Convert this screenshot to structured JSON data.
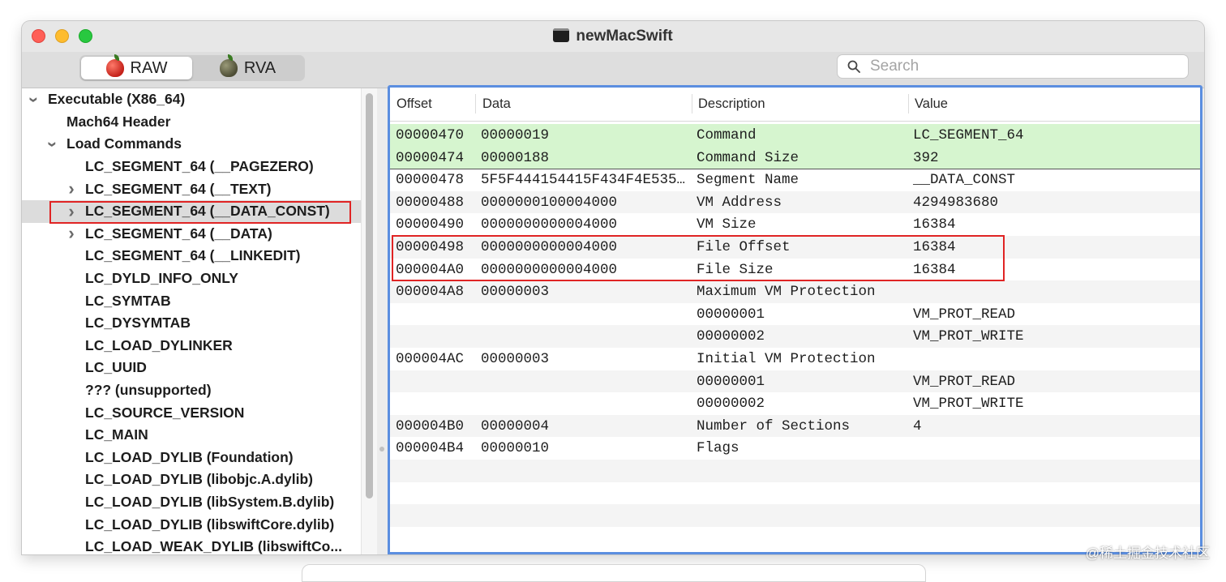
{
  "window": {
    "title": "newMacSwift"
  },
  "toolbar": {
    "modes": [
      {
        "label": "RAW",
        "active": true
      },
      {
        "label": "RVA",
        "active": false
      }
    ],
    "search": {
      "placeholder": "Search"
    }
  },
  "sidebar": {
    "items": [
      {
        "label": "Executable  (X86_64)",
        "level": 0,
        "disclosure": "expanded"
      },
      {
        "label": "Mach64 Header",
        "level": 1,
        "disclosure": "none"
      },
      {
        "label": "Load Commands",
        "level": 1,
        "disclosure": "expanded"
      },
      {
        "label": "LC_SEGMENT_64 (__PAGEZERO)",
        "level": 2,
        "disclosure": "none"
      },
      {
        "label": "LC_SEGMENT_64 (__TEXT)",
        "level": 2,
        "disclosure": "collapsed"
      },
      {
        "label": "LC_SEGMENT_64 (__DATA_CONST)",
        "level": 2,
        "disclosure": "collapsed",
        "selected": true
      },
      {
        "label": "LC_SEGMENT_64 (__DATA)",
        "level": 2,
        "disclosure": "collapsed"
      },
      {
        "label": "LC_SEGMENT_64 (__LINKEDIT)",
        "level": 2,
        "disclosure": "none"
      },
      {
        "label": "LC_DYLD_INFO_ONLY",
        "level": 2,
        "disclosure": "none"
      },
      {
        "label": "LC_SYMTAB",
        "level": 2,
        "disclosure": "none"
      },
      {
        "label": "LC_DYSYMTAB",
        "level": 2,
        "disclosure": "none"
      },
      {
        "label": "LC_LOAD_DYLINKER",
        "level": 2,
        "disclosure": "none"
      },
      {
        "label": "LC_UUID",
        "level": 2,
        "disclosure": "none"
      },
      {
        "label": "??? (unsupported)",
        "level": 2,
        "disclosure": "none"
      },
      {
        "label": "LC_SOURCE_VERSION",
        "level": 2,
        "disclosure": "none"
      },
      {
        "label": "LC_MAIN",
        "level": 2,
        "disclosure": "none"
      },
      {
        "label": "LC_LOAD_DYLIB (Foundation)",
        "level": 2,
        "disclosure": "none"
      },
      {
        "label": "LC_LOAD_DYLIB (libobjc.A.dylib)",
        "level": 2,
        "disclosure": "none"
      },
      {
        "label": "LC_LOAD_DYLIB (libSystem.B.dylib)",
        "level": 2,
        "disclosure": "none"
      },
      {
        "label": "LC_LOAD_DYLIB (libswiftCore.dylib)",
        "level": 2,
        "disclosure": "none"
      },
      {
        "label": "LC_LOAD_WEAK_DYLIB (libswiftCo...",
        "level": 2,
        "disclosure": "none"
      }
    ]
  },
  "table": {
    "columns": [
      "Offset",
      "Data",
      "Description",
      "Value"
    ],
    "rows": [
      {
        "offset": "00000470",
        "data": "00000019",
        "description": "Command",
        "value": "LC_SEGMENT_64",
        "highlight": true
      },
      {
        "offset": "00000474",
        "data": "00000188",
        "description": "Command Size",
        "value": "392",
        "highlight": true
      },
      {
        "offset": "00000478",
        "data": "5F5F444154415F434F4E535…",
        "description": "Segment Name",
        "value": "__DATA_CONST"
      },
      {
        "offset": "00000488",
        "data": "0000000100004000",
        "description": "VM Address",
        "value": "4294983680"
      },
      {
        "offset": "00000490",
        "data": "0000000000004000",
        "description": "VM Size",
        "value": "16384"
      },
      {
        "offset": "00000498",
        "data": "0000000000004000",
        "description": "File Offset",
        "value": "16384"
      },
      {
        "offset": "000004A0",
        "data": "0000000000004000",
        "description": "File Size",
        "value": "16384"
      },
      {
        "offset": "000004A8",
        "data": "00000003",
        "description": "Maximum VM Protection",
        "value": ""
      },
      {
        "offset": "",
        "data": "",
        "description": "00000001",
        "value": "VM_PROT_READ"
      },
      {
        "offset": "",
        "data": "",
        "description": "00000002",
        "value": "VM_PROT_WRITE"
      },
      {
        "offset": "000004AC",
        "data": "00000003",
        "description": "Initial VM Protection",
        "value": ""
      },
      {
        "offset": "",
        "data": "",
        "description": "00000001",
        "value": "VM_PROT_READ"
      },
      {
        "offset": "",
        "data": "",
        "description": "00000002",
        "value": "VM_PROT_WRITE"
      },
      {
        "offset": "000004B0",
        "data": "00000004",
        "description": "Number of Sections",
        "value": "4"
      },
      {
        "offset": "000004B4",
        "data": "00000010",
        "description": "Flags",
        "value": ""
      },
      {
        "offset": "",
        "data": "",
        "description": "",
        "value": ""
      },
      {
        "offset": "",
        "data": "",
        "description": "",
        "value": ""
      },
      {
        "offset": "",
        "data": "",
        "description": "",
        "value": ""
      },
      {
        "offset": "",
        "data": "",
        "description": "",
        "value": ""
      }
    ]
  },
  "watermark": "@稀土掘金技术社区",
  "colors": {
    "accent": "#5b8ee0",
    "highlight": "#d6f5cf",
    "annotation": "#e02424"
  }
}
